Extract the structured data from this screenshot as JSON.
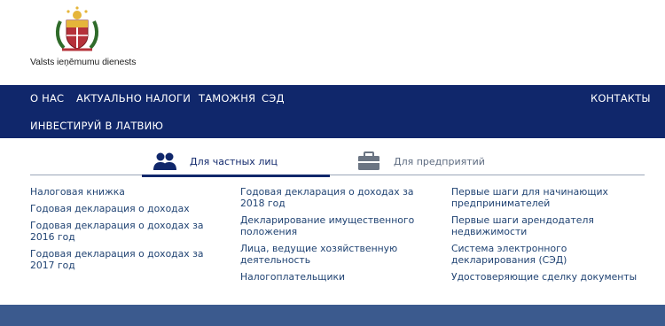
{
  "brand": {
    "name": "Valsts ieņēmumu dienests",
    "logo_icon": "coat-of-arms-icon"
  },
  "nav": {
    "items": [
      "О НАС",
      "АКТУАЛЬНО",
      "НАЛОГИ",
      "ТАМОЖНЯ",
      "СЭД"
    ],
    "contacts": "КОНТАКТЫ",
    "invest": "ИНВЕСТИРУЙ В ЛАТВИЮ"
  },
  "tabs": [
    {
      "label": "Для частных лиц",
      "icon": "people-icon",
      "active": true
    },
    {
      "label": "Для предприятий",
      "icon": "briefcase-icon",
      "active": false
    }
  ],
  "links": {
    "col1": [
      "Налоговая книжка",
      "Годовая декларация о доходах",
      "Годовая декларация о доходах за 2016 год",
      "Годовая декларация о доходах за 2017 год"
    ],
    "col2": [
      "Годовая декларация о доходах за 2018 год",
      "Декларирование имущественного положения",
      "Лица, ведущие хозяйственную деятельность",
      "Налогоплательщики"
    ],
    "col3": [
      "Первые шаги для начинающих предпринимателей",
      "Первые шаги арендодателя недвижимости",
      "Система электронного декларирования (СЭД)",
      "Удостоверяющие сделку документы"
    ]
  },
  "colors": {
    "nav_bg": "#10276b",
    "link": "#1f4272",
    "footer": "#3b5a8e"
  }
}
